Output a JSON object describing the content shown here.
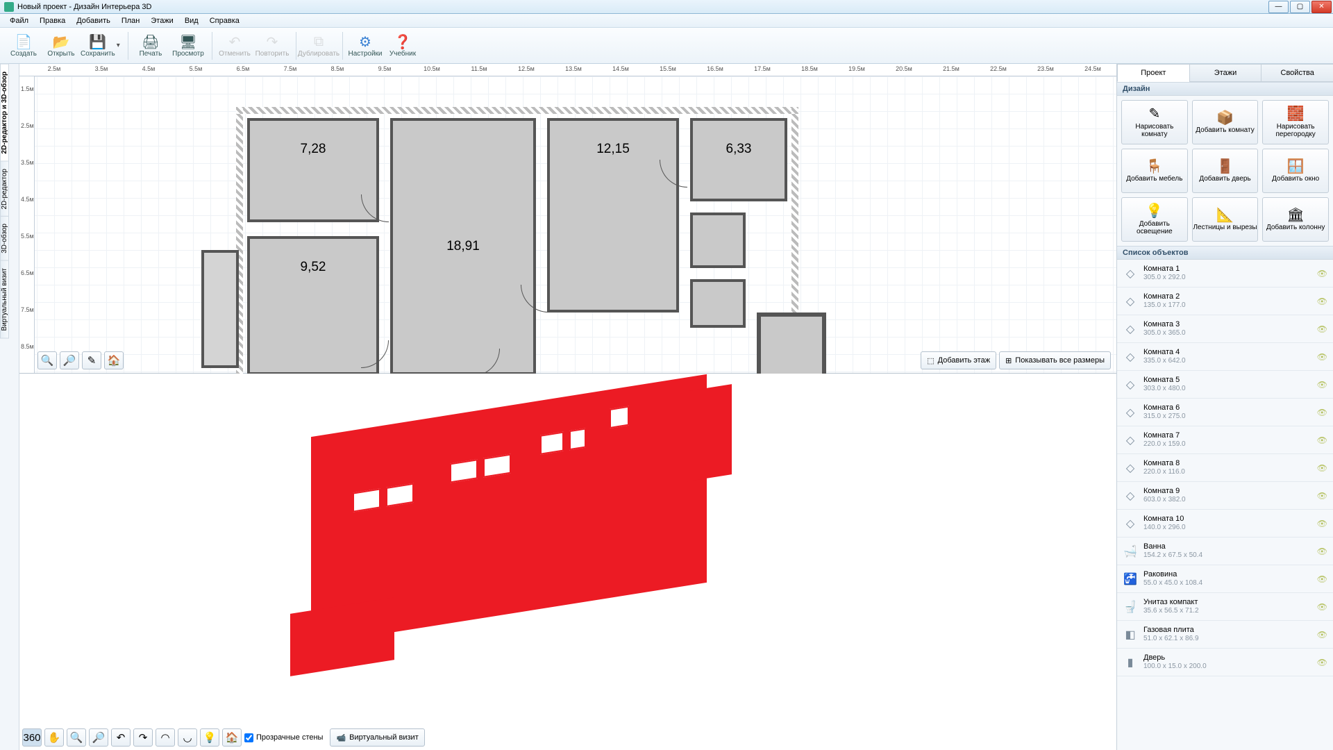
{
  "title": "Новый проект - Дизайн Интерьера 3D",
  "menu": [
    "Файл",
    "Правка",
    "Добавить",
    "План",
    "Этажи",
    "Вид",
    "Справка"
  ],
  "toolbar": {
    "create": "Создать",
    "open": "Открыть",
    "save": "Сохранить",
    "print": "Печать",
    "preview": "Просмотр",
    "undo": "Отменить",
    "redo": "Повторить",
    "dup": "Дублировать",
    "settings": "Настройки",
    "tutorial": "Учебник"
  },
  "ruler_h": [
    "2.5м",
    "3.5м",
    "4.5м",
    "5.5м",
    "6.5м",
    "7.5м",
    "8.5м",
    "9.5м",
    "10.5м",
    "11.5м",
    "12.5м",
    "13.5м",
    "14.5м",
    "15.5м",
    "16.5м",
    "17.5м",
    "18.5м",
    "19.5м",
    "20.5м",
    "21.5м",
    "22.5м",
    "23.5м",
    "24.5м"
  ],
  "ruler_v": [
    "1.5м",
    "2.5м",
    "3.5м",
    "4.5м",
    "5.5м",
    "6.5м",
    "7.5м",
    "8.5м"
  ],
  "lefttabs": [
    "2D-редактор и 3D-обзор",
    "2D-редактор",
    "3D-обзор",
    "Виртуальный визит"
  ],
  "rooms": {
    "r1": "7,28",
    "r2": "18,91",
    "r3": "12,15",
    "r4": "6,33",
    "r5": "9,52"
  },
  "planfoot": {
    "add_floor": "Добавить этаж",
    "show_dims": "Показывать все размеры"
  },
  "foot3d": {
    "transparent": "Прозрачные стены",
    "virtual": "Виртуальный визит"
  },
  "rtabs": [
    "Проект",
    "Этажи",
    "Свойства"
  ],
  "rsec_design": "Дизайн",
  "rsec_objects": "Список объектов",
  "design_btns": [
    "Нарисовать комнату",
    "Добавить комнату",
    "Нарисовать перегородку",
    "Добавить мебель",
    "Добавить дверь",
    "Добавить окно",
    "Добавить освещение",
    "Лестницы и вырезы",
    "Добавить колонну"
  ],
  "design_icons": [
    "✎",
    "📦",
    "🧱",
    "🪑",
    "🚪",
    "🪟",
    "💡",
    "📐",
    "🏛"
  ],
  "objects": [
    {
      "n": "Комната 1",
      "d": "305.0 x 292.0",
      "i": "◇"
    },
    {
      "n": "Комната 2",
      "d": "135.0 x 177.0",
      "i": "◇"
    },
    {
      "n": "Комната 3",
      "d": "305.0 x 365.0",
      "i": "◇"
    },
    {
      "n": "Комната 4",
      "d": "335.0 x 642.0",
      "i": "◇"
    },
    {
      "n": "Комната 5",
      "d": "303.0 x 480.0",
      "i": "◇"
    },
    {
      "n": "Комната 6",
      "d": "315.0 x 275.0",
      "i": "◇"
    },
    {
      "n": "Комната 7",
      "d": "220.0 x 159.0",
      "i": "◇"
    },
    {
      "n": "Комната 8",
      "d": "220.0 x 116.0",
      "i": "◇"
    },
    {
      "n": "Комната 9",
      "d": "603.0 x 382.0",
      "i": "◇"
    },
    {
      "n": "Комната 10",
      "d": "140.0 x 296.0",
      "i": "◇"
    },
    {
      "n": "Ванна",
      "d": "154.2 x 67.5 x 50.4",
      "i": "🛁"
    },
    {
      "n": "Раковина",
      "d": "55.0 x 45.0 x 108.4",
      "i": "🚰"
    },
    {
      "n": "Унитаз компакт",
      "d": "35.6 x 56.5 x 71.2",
      "i": "🚽"
    },
    {
      "n": "Газовая плита",
      "d": "51.0 x 62.1 x 86.9",
      "i": "◧"
    },
    {
      "n": "Дверь",
      "d": "100.0 x 15.0 x 200.0",
      "i": "▮"
    }
  ]
}
